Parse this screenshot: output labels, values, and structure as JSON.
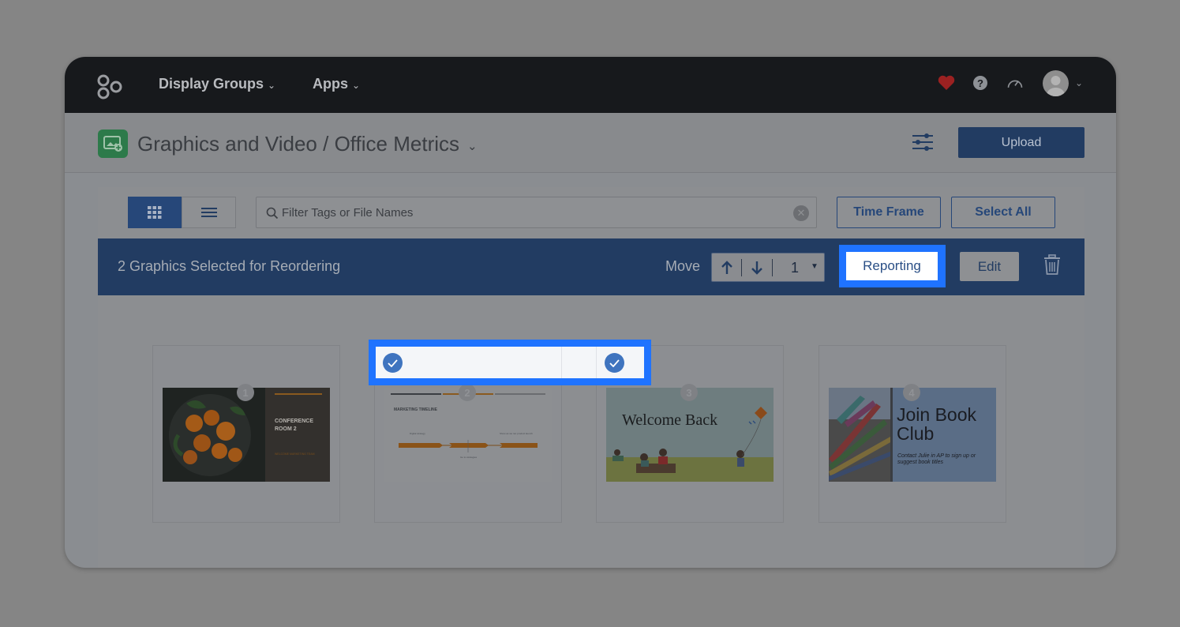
{
  "topnav": {
    "items": [
      {
        "label": "Display Groups"
      },
      {
        "label": "Apps"
      }
    ]
  },
  "header": {
    "title": "Graphics and Video / Office Metrics",
    "upload_label": "Upload"
  },
  "toolbar": {
    "search_placeholder": "Filter Tags or File Names",
    "time_frame_label": "Time Frame",
    "select_all_label": "Select All"
  },
  "selection_bar": {
    "text": "2 Graphics Selected for Reordering",
    "move_label": "Move",
    "position_value": "1",
    "reporting_label": "Reporting",
    "edit_label": "Edit"
  },
  "cards": [
    {
      "number": "1",
      "title": "CONFERENCE ROOM 2",
      "subtitle": "WELCOME MARKETING TEAM"
    },
    {
      "number": "2",
      "title": "MARKETING TIMELINE",
      "label_left": "Digital strategy",
      "label_right": "Show as we ran product launch",
      "label_bottom": "Go to strategies"
    },
    {
      "number": "3",
      "title": "Welcome Back"
    },
    {
      "number": "4",
      "title": "Join Book Club",
      "subtitle": "Contact Julie in AP to sign up or suggest book titles"
    }
  ],
  "colors": {
    "nav_bg": "#17191c",
    "accent": "#223c62",
    "highlight": "#1f73ff",
    "check": "#3f74bf"
  }
}
